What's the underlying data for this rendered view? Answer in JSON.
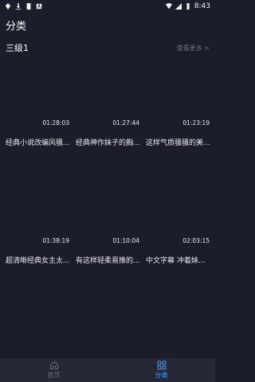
{
  "status_bar": {
    "time": "8:43"
  },
  "page": {
    "title": "分类"
  },
  "section": {
    "title": "三级1",
    "more_label": "查看更多 >"
  },
  "videos": [
    {
      "duration": "01:28:03",
      "title": "经典小说改编风骚..."
    },
    {
      "duration": "01:27:44",
      "title": "经典神作妹子的胸..."
    },
    {
      "duration": "01:23:19",
      "title": "这样气质骚骚的美..."
    },
    {
      "duration": "01:38:19",
      "title": "超清晰经典女主太..."
    },
    {
      "duration": "01:10:04",
      "title": "有这样轻柔易推的..."
    },
    {
      "duration": "02:03:15",
      "title": "中文字幕 冲着妹子..."
    }
  ],
  "tabbar": {
    "home_label": "首页",
    "category_label": "分类",
    "active_color": "#49a3ff",
    "inactive_color": "#6a6d80"
  }
}
